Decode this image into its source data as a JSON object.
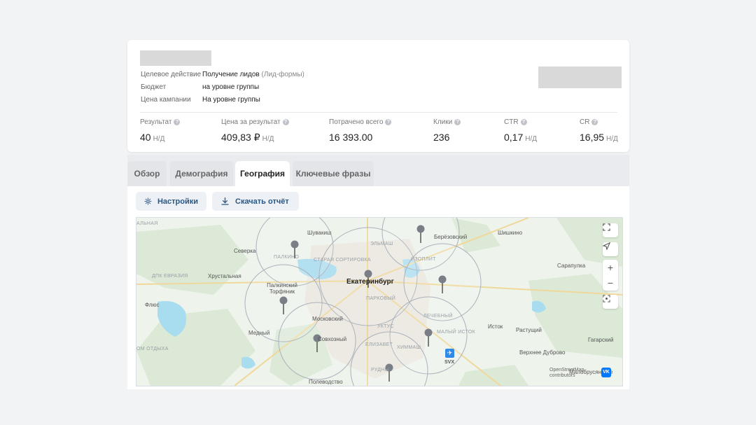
{
  "campaign": {
    "info": [
      {
        "key": "Целевое действие",
        "value": "Получение лидов",
        "hint": "(Лид-формы)"
      },
      {
        "key": "Бюджет",
        "value": "на уровне группы",
        "hint": ""
      },
      {
        "key": "Цена кампании",
        "value": "На уровне группы",
        "hint": ""
      }
    ],
    "metrics": [
      {
        "label": "Результат",
        "value": "40",
        "na": "Н/Д"
      },
      {
        "label": "Цена за результат",
        "value": "409,83 ₽",
        "na": "Н/Д"
      },
      {
        "label": "Потрачено всего",
        "value": "16 393.00",
        "na": ""
      },
      {
        "label": "Клики",
        "value": "236",
        "na": ""
      },
      {
        "label": "CTR",
        "value": "0,17",
        "na": "Н/Д"
      },
      {
        "label": "CR",
        "value": "16,95",
        "na": "Н/Д"
      }
    ]
  },
  "tabs": [
    "Обзор",
    "Демография",
    "География",
    "Ключевые фразы"
  ],
  "active_tab": "География",
  "toolbar": {
    "settings_label": "Настройки",
    "download_label": "Скачать отчёт"
  },
  "map": {
    "labels": {
      "ekb": "Екатеринбург",
      "shuvakish": "Шувакиш",
      "severka": "Северка",
      "palkino": "ПАЛКИНО",
      "staraya": "СТАРАЯ СОРТИРОВКА",
      "elmash": "ЭЛЬМАШ",
      "berezovsky": "Берёзовский",
      "shishkino": "Шишкино",
      "izoplit": "ИЗОПЛИТ",
      "sarapulka": "Сарапулка",
      "dpk": "ДПК ЕВРАЗИЯ",
      "khrustalnaya": "Хрустальная",
      "palkinsky": "Палкинский Торфяник",
      "flyus": "Флюс",
      "parkovy": "ПАРКОВЫЙ",
      "lechebny": "ЛЕЧЕБНЫЙ",
      "moskovsky": "Московский",
      "uktus": "УКТУС",
      "maly_istok": "МАЛЫЙ ИСТОК",
      "istok": "Исток",
      "rastushchiy": "Растущий",
      "medny": "Медный",
      "gagarsky": "Гагарский",
      "elizavet": "ЕЛИЗАВЕТ",
      "khimmash": "ХИММАШ",
      "verkhnee": "Верхнее Дуброво",
      "malobrusyanskoe": "Малобрусянское",
      "rudny": "РУДНЫ",
      "polevodstvo": "Полеводство",
      "otdykha": "ОМ ОТДЫХА",
      "svx": "SVX",
      "sovkhozny": "Совхозный",
      "alnaya": "АЛЬНАЯ"
    },
    "attribution": "OpenStreetMap contributors",
    "vk": "VK"
  }
}
